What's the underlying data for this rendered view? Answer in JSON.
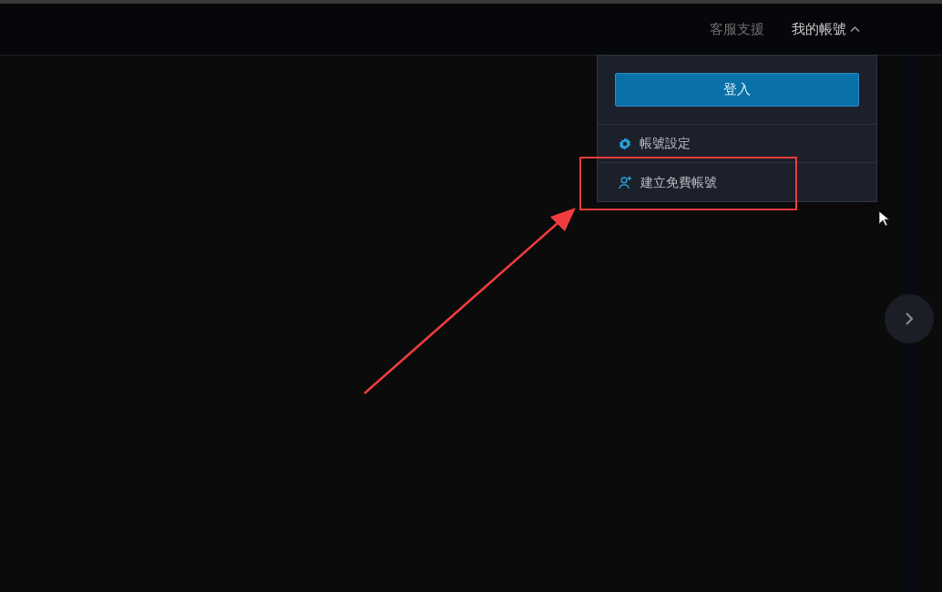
{
  "top_nav": [
    {
      "label": "客服支援",
      "kind": "link"
    },
    {
      "label": "我的帳號",
      "kind": "menu",
      "expanded": true
    }
  ],
  "account_menu": {
    "login_button": "登入",
    "items": [
      {
        "label": "帳號設定",
        "kind": "settings"
      },
      {
        "label": "建立免費帳號",
        "kind": "create_account"
      }
    ]
  }
}
